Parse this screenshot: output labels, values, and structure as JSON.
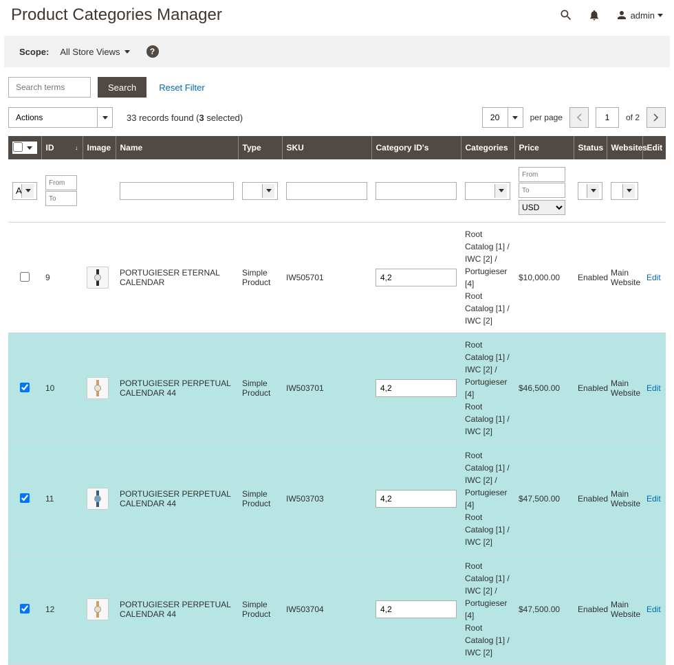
{
  "page_title": "Product Categories Manager",
  "user_label": "admin",
  "scope": {
    "label": "Scope:",
    "value": "All Store Views"
  },
  "search": {
    "placeholder": "Search terms",
    "button": "Search",
    "reset": "Reset Filter"
  },
  "actions_label": "Actions",
  "records_prefix": "33 records found (",
  "records_count": "3",
  "records_suffix": " selected)",
  "per_page_value": "20",
  "per_page_label": "per page",
  "page_current": "1",
  "page_total": "of 2",
  "columns": {
    "checkbox": "",
    "id": "ID",
    "image": "Image",
    "name": "Name",
    "type": "Type",
    "sku": "SKU",
    "category_ids": "Category ID's",
    "categories": "Categories",
    "price": "Price",
    "status": "Status",
    "websites": "Websites",
    "edit": "Edit"
  },
  "filter": {
    "check_any": "Any",
    "id_from": "From",
    "id_to": "To",
    "price_from": "From",
    "price_to": "To",
    "currency": "USD"
  },
  "rows": [
    {
      "selected": false,
      "checked": false,
      "id": "9",
      "name": "PORTUGIESER ETERNAL CALENDAR",
      "type": "Simple Product",
      "sku": "IW505701",
      "cat_ids": "4,2",
      "categories": "Root Catalog [1] / IWC [2] / Portugieser [4]\nRoot Catalog [1] / IWC [2]",
      "price": "$10,000.00",
      "status": "Enabled",
      "website": "Main Website",
      "face": "#e8e4dd",
      "band": "#2c2c2c"
    },
    {
      "selected": true,
      "checked": true,
      "id": "10",
      "name": "PORTUGIESER PERPETUAL CALENDAR 44",
      "type": "Simple Product",
      "sku": "IW503701",
      "cat_ids": "4,2",
      "categories": "Root Catalog [1] / IWC [2] / Portugieser [4]\nRoot Catalog [1] / IWC [2]",
      "price": "$46,500.00",
      "status": "Enabled",
      "website": "Main Website",
      "face": "#eae3d2",
      "band": "#c7a36a"
    },
    {
      "selected": true,
      "checked": true,
      "id": "11",
      "name": "PORTUGIESER PERPETUAL CALENDAR 44",
      "type": "Simple Product",
      "sku": "IW503703",
      "cat_ids": "4,2",
      "categories": "Root Catalog [1] / IWC [2] / Portugieser [4]\nRoot Catalog [1] / IWC [2]",
      "price": "$47,500.00",
      "status": "Enabled",
      "website": "Main Website",
      "face": "#6fa3c7",
      "band": "#3a5a78"
    },
    {
      "selected": true,
      "checked": true,
      "id": "12",
      "name": "PORTUGIESER PERPETUAL CALENDAR 44",
      "type": "Simple Product",
      "sku": "IW503704",
      "cat_ids": "4,2",
      "categories": "Root Catalog [1] / IWC [2] / Portugieser [4]\nRoot Catalog [1] / IWC [2]",
      "price": "$47,500.00",
      "status": "Enabled",
      "website": "Main Website",
      "face": "#e8dcc5",
      "band": "#c7a36a"
    }
  ],
  "edit_label": "Edit"
}
